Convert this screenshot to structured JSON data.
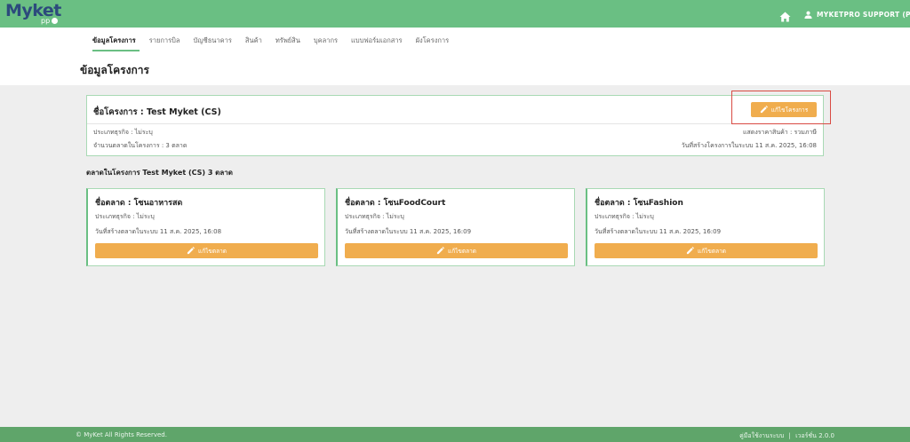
{
  "header": {
    "logo_text": "Myket",
    "logo_sub": "pp",
    "user_name": "MYKETPRO SUPPORT (P)"
  },
  "tabs": [
    {
      "label": "ข้อมูลโครงการ",
      "active": true
    },
    {
      "label": "รายการบิล"
    },
    {
      "label": "บัญชีธนาคาร"
    },
    {
      "label": "สินค้า"
    },
    {
      "label": "ทรัพย์สิน"
    },
    {
      "label": "บุคลากร"
    },
    {
      "label": "แบบฟอร์มเอกสาร"
    },
    {
      "label": "ผังโครงการ"
    }
  ],
  "page_title": "ข้อมูลโครงการ",
  "project": {
    "name": "ชื่อโครงการ : Test Myket (CS)",
    "edit_label": "แก้ไขโครงการ",
    "business_type": "ประเภทธุรกิจ : ไม่ระบุ",
    "market_count": "จำนวนตลาดในโครงการ : 3 ตลาด",
    "price_display": "แสดงราคาสินค้า : รวมภาษี",
    "created": "วันที่สร้างโครงการในระบบ 11 ส.ค. 2025, 16:08"
  },
  "markets_section_title": "ตลาดในโครงการ Test Myket (CS) 3 ตลาด",
  "markets": [
    {
      "name": "ชื่อตลาด : โซนอาหารสด",
      "business_type": "ประเภทธุรกิจ : ไม่ระบุ",
      "created": "วันที่สร้างตลาดในระบบ 11 ส.ค. 2025, 16:08",
      "edit_label": "แก้ไขตลาด"
    },
    {
      "name": "ชื่อตลาด : โซนFoodCourt",
      "business_type": "ประเภทธุรกิจ : ไม่ระบุ",
      "created": "วันที่สร้างตลาดในระบบ 11 ส.ค. 2025, 16:09",
      "edit_label": "แก้ไขตลาด"
    },
    {
      "name": "ชื่อตลาด : โซนFashion",
      "business_type": "ประเภทธุรกิจ : ไม่ระบุ",
      "created": "วันที่สร้างตลาดในระบบ 11 ส.ค. 2025, 16:09",
      "edit_label": "แก้ไขตลาด"
    }
  ],
  "footer": {
    "copyright": "© MyKet All Rights Reserved.",
    "manual": "คู่มือใช้งานระบบ",
    "separator": "|",
    "version": "เวอร์ชั่น 2.0.0"
  },
  "icons": {
    "home": "home-icon",
    "user": "user-icon",
    "pencil": "pencil-icon"
  },
  "colors": {
    "primary_green": "#6abf83",
    "footer_green": "#5fa56a",
    "button_orange": "#f0ad4e",
    "highlight_red": "#d94b43",
    "logo_blue": "#2c4a7c"
  }
}
